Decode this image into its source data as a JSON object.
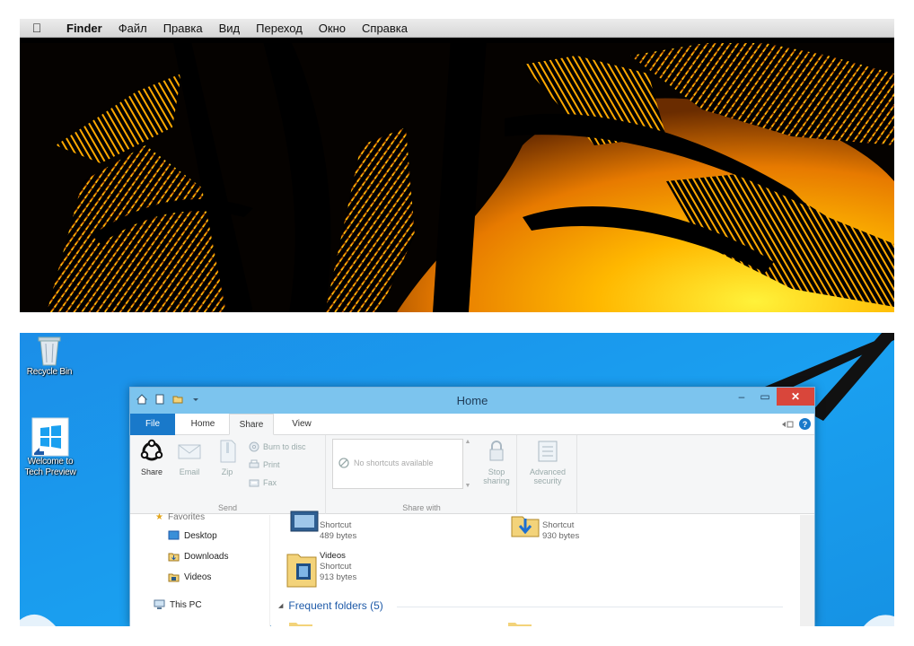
{
  "mac": {
    "menubar": {
      "apple_icon": "apple-logo-icon",
      "app_name": "Finder",
      "menus": [
        "Файл",
        "Правка",
        "Вид",
        "Переход",
        "Окно",
        "Справка"
      ]
    },
    "wallpaper": "palm-trees-sunset"
  },
  "windows": {
    "desktop_icons": [
      {
        "label": "Recycle Bin",
        "icon": "recycle-bin-icon"
      },
      {
        "label_line1": "Welcome to",
        "label_line2": "Tech Preview",
        "icon": "windows-logo-icon"
      }
    ],
    "explorer": {
      "title": "Home",
      "window_buttons": {
        "minimize": "–",
        "maximize": "▭",
        "close": "✕"
      },
      "tabs": [
        "File",
        "Home",
        "Share",
        "View"
      ],
      "selected_tab": "Share",
      "help_glyph": "?",
      "ribbon": {
        "send": {
          "share": "Share",
          "email": "Email",
          "zip": "Zip",
          "burn": "Burn to disc",
          "print": "Print",
          "fax": "Fax",
          "group_label": "Send"
        },
        "share_with": {
          "placeholder": "No shortcuts available",
          "stop_sharing_line1": "Stop",
          "stop_sharing_line2": "sharing",
          "group_label": "Share with"
        },
        "advanced": {
          "line1": "Advanced",
          "line2": "security"
        }
      },
      "nav": {
        "partial_label": "Favorites",
        "items": [
          "Desktop",
          "Downloads",
          "Videos"
        ],
        "this_pc": "This PC"
      },
      "files": [
        {
          "type": "Shortcut",
          "size": "489 bytes"
        },
        {
          "type": "Shortcut",
          "size": "930 bytes"
        },
        {
          "name": "Videos",
          "type": "Shortcut",
          "size": "913 bytes"
        }
      ],
      "frequent_folders": "Frequent folders (5)"
    },
    "colors": {
      "desktop_blue": "#1aa0f0",
      "titlebar": "#7cc4ee",
      "file_tab": "#1979ca",
      "close_button": "#d9463b"
    }
  }
}
